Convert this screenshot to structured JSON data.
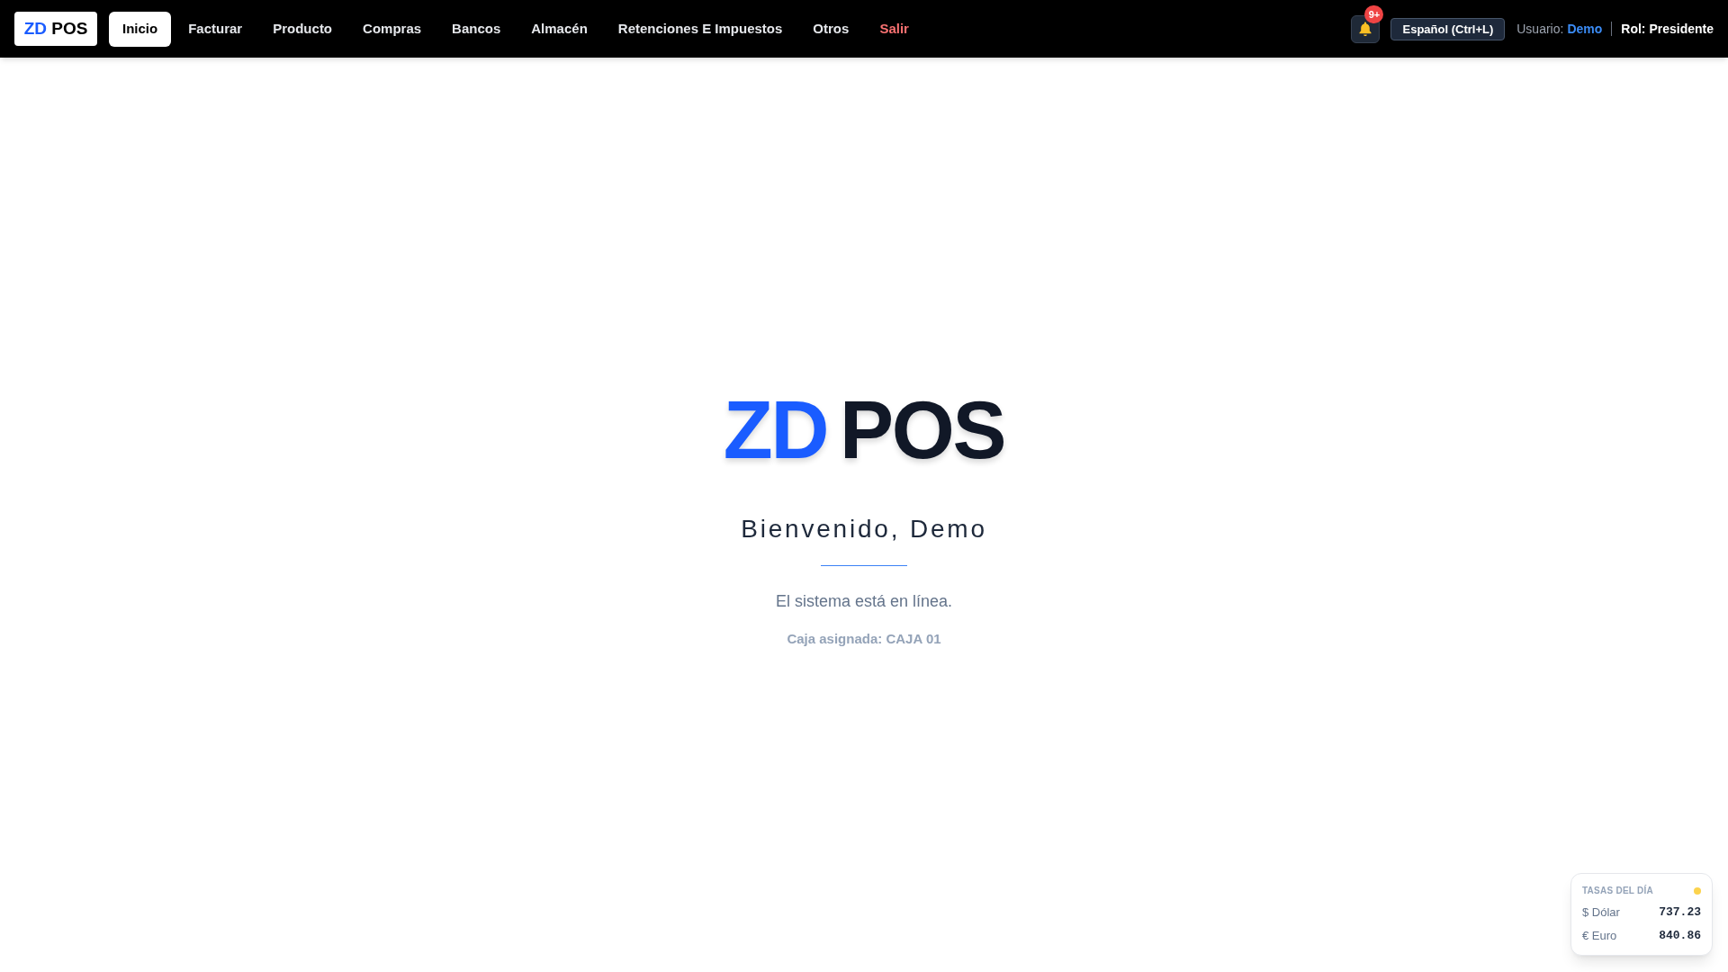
{
  "navbar": {
    "logo": {
      "accent": "ZD",
      "name": "POS"
    },
    "menu": [
      {
        "label": "Inicio",
        "kind": "page",
        "selected": true
      },
      {
        "label": "Facturar",
        "kind": "page",
        "selected": false
      },
      {
        "label": "Producto",
        "kind": "page",
        "selected": false
      },
      {
        "label": "Compras",
        "kind": "page",
        "selected": false
      },
      {
        "label": "Bancos",
        "kind": "page",
        "selected": false
      },
      {
        "label": "Almacén",
        "kind": "page",
        "selected": false
      },
      {
        "label": "Retenciones E Impuestos",
        "kind": "page",
        "selected": false
      },
      {
        "label": "Otros",
        "kind": "page",
        "selected": false
      },
      {
        "label": "Salir",
        "kind": "logout",
        "selected": false
      }
    ],
    "notifications": {
      "badge": "9+"
    },
    "language_button": "Español (Ctrl+L)",
    "user": {
      "label": "Usuario:",
      "name": "Demo"
    },
    "role": "Rol: Presidente"
  },
  "welcome": {
    "logo": {
      "accent": "ZD",
      "name": "POS"
    },
    "greeting": "Bienvenido, Demo",
    "status": "El sistema está en línea.",
    "register": "Caja asignada: CAJA 01"
  },
  "rates_widget": {
    "title": "TASAS DEL DÍA",
    "rates": [
      {
        "label": "$ Dólar",
        "value": "737.23"
      },
      {
        "label": "€ Euro",
        "value": "840.86"
      }
    ]
  }
}
